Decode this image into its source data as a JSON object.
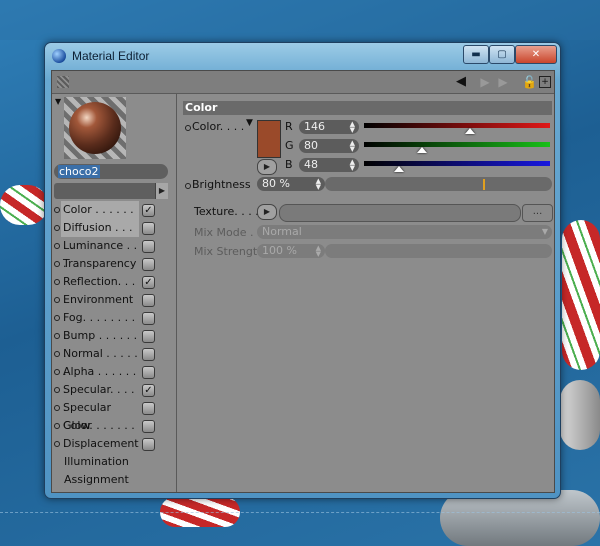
{
  "window": {
    "title": "Material Editor",
    "controls": {
      "minimize": "▬",
      "maximize": "▢",
      "close": "✕"
    }
  },
  "toolbar": {
    "icons": [
      "grip-icon",
      "back-arrow-icon",
      "forward-arrow-icon",
      "lock-icon",
      "new-window-icon"
    ]
  },
  "material": {
    "name": "choco2",
    "channels": [
      {
        "label": "Color . . . . . . .",
        "checked": true,
        "active": true
      },
      {
        "label": "Diffusion . . . . .",
        "checked": false
      },
      {
        "label": "Luminance . . .",
        "checked": false
      },
      {
        "label": "Transparency",
        "checked": false
      },
      {
        "label": "Reflection. . . . .",
        "checked": true
      },
      {
        "label": "Environment",
        "checked": false
      },
      {
        "label": "Fog. . . . . . . . .",
        "checked": false
      },
      {
        "label": "Bump . . . . . . .",
        "checked": false
      },
      {
        "label": "Normal . . . . . .",
        "checked": false
      },
      {
        "label": "Alpha . . . . . . .",
        "checked": false
      },
      {
        "label": "Specular. . . . .",
        "checked": true
      },
      {
        "label": "Specular Color",
        "checked": false
      },
      {
        "label": "Glow. . . . . . . .",
        "checked": false
      },
      {
        "label": "Displacement",
        "checked": false
      }
    ],
    "extra_items": [
      "Illumination",
      "Assignment"
    ]
  },
  "color_section": {
    "title": "Color",
    "color_label": "Color. . . .",
    "swatch_color": "#9a4a2a",
    "r_label": "R",
    "r_value": "146",
    "r_fraction": 0.57,
    "g_label": "G",
    "g_value": "80",
    "g_fraction": 0.31,
    "b_label": "B",
    "b_value": "48",
    "b_fraction": 0.19,
    "brightness_label": "Brightness",
    "brightness_value": "80 %",
    "brightness_fraction": 0.8,
    "texture_label": "Texture. . . .",
    "texture_more": "...",
    "mix_mode_label": "Mix Mode . .",
    "mix_mode_value": "Normal",
    "mix_strength_label": "Mix Strength",
    "mix_strength_value": "100 %"
  },
  "colors": {
    "red_slider": "#e01818",
    "green_slider": "#18c018",
    "blue_slider": "#1818e0",
    "brightness_marker": "#e0a020"
  }
}
